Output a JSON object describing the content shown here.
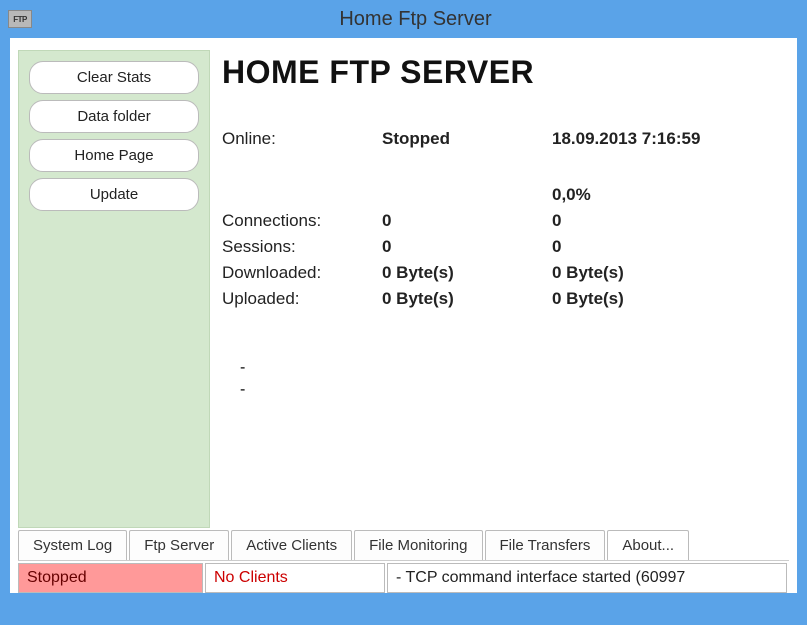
{
  "titlebar": {
    "icon_label": "FTP",
    "title": "Home Ftp Server"
  },
  "sidebar": {
    "buttons": {
      "clear_stats": "Clear Stats",
      "data_folder": "Data folder",
      "home_page": "Home Page",
      "update": "Update"
    }
  },
  "main": {
    "heading": "HOME FTP SERVER",
    "labels": {
      "online": "Online:",
      "connections": "Connections:",
      "sessions": "Sessions:",
      "downloaded": "Downloaded:",
      "uploaded": "Uploaded:"
    },
    "values": {
      "online_status": "Stopped",
      "timestamp": "18.09.2013 7:16:59",
      "percent": "0,0%",
      "connections_current": "0",
      "connections_total": "0",
      "sessions_current": "0",
      "sessions_total": "0",
      "downloaded_current": "0 Byte(s)",
      "downloaded_total": "0 Byte(s)",
      "uploaded_current": "0 Byte(s)",
      "uploaded_total": "0 Byte(s)"
    },
    "dash1": "-",
    "dash2": "-"
  },
  "tabs": {
    "system_log": "System Log",
    "ftp_server": "Ftp Server",
    "active_clients": "Active Clients",
    "file_monitoring": "File Monitoring",
    "file_transfers": "File Transfers",
    "about": "About..."
  },
  "statusbar": {
    "status": "Stopped",
    "clients": "No Clients",
    "message": "- TCP command interface started (60997"
  }
}
